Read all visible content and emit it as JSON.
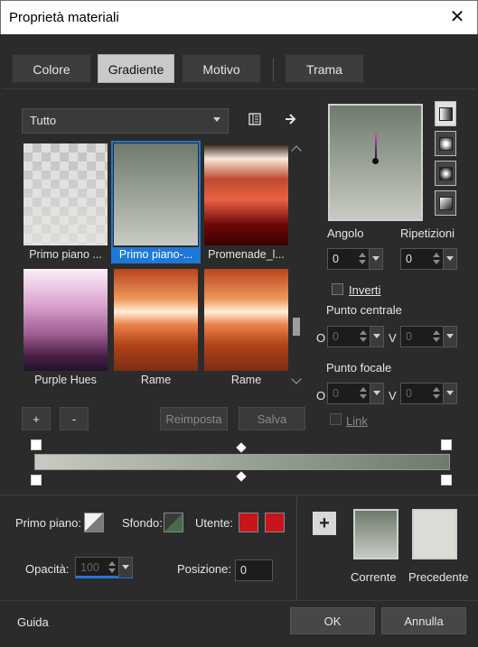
{
  "window": {
    "title": "Proprietà materiali",
    "close_glyph": "✕"
  },
  "tabs": [
    "Colore",
    "Gradiente",
    "Motivo",
    "Trama"
  ],
  "active_tab": "Gradiente",
  "category": {
    "selected": "Tutto"
  },
  "gradients": [
    {
      "label": "Primo piano ...",
      "selected": false
    },
    {
      "label": "Primo piano-...",
      "selected": true
    },
    {
      "label": "Promenade_l...",
      "selected": false
    },
    {
      "label": "Purple Hues",
      "selected": false
    },
    {
      "label": "Rame",
      "selected": false
    },
    {
      "label": "Rame",
      "selected": false
    }
  ],
  "library_buttons": {
    "add": "+",
    "remove": "-",
    "reset": "Reimposta",
    "save": "Salva"
  },
  "props": {
    "angle_label": "Angolo",
    "angle_value": "0",
    "repeats_label": "Ripetizioni",
    "repeats_value": "0",
    "invert_label": "Inverti",
    "center_label": "Punto centrale",
    "center_o": "0",
    "center_v": "0",
    "focal_label": "Punto focale",
    "focal_o": "0",
    "focal_v": "0",
    "link_label": "Link",
    "o_label": "O",
    "v_label": "V"
  },
  "gradient_colors": {
    "start": "#c7cbc3",
    "end": "#6e7a6c"
  },
  "materials": {
    "foreground_label": "Primo piano:",
    "background_label": "Sfondo:",
    "user_label": "Utente:",
    "user_colors": [
      "#c8141b",
      "#c8141b"
    ],
    "opacity_label": "Opacità:",
    "opacity_value": "100",
    "position_label": "Posizione:",
    "position_value": "0",
    "add_button": "+",
    "current_label": "Corrente",
    "previous_label": "Precedente",
    "current_color": "#6e7a6c",
    "previous_color": "#dcdcd6"
  },
  "footer": {
    "help": "Guida",
    "ok": "OK",
    "cancel": "Annulla"
  }
}
